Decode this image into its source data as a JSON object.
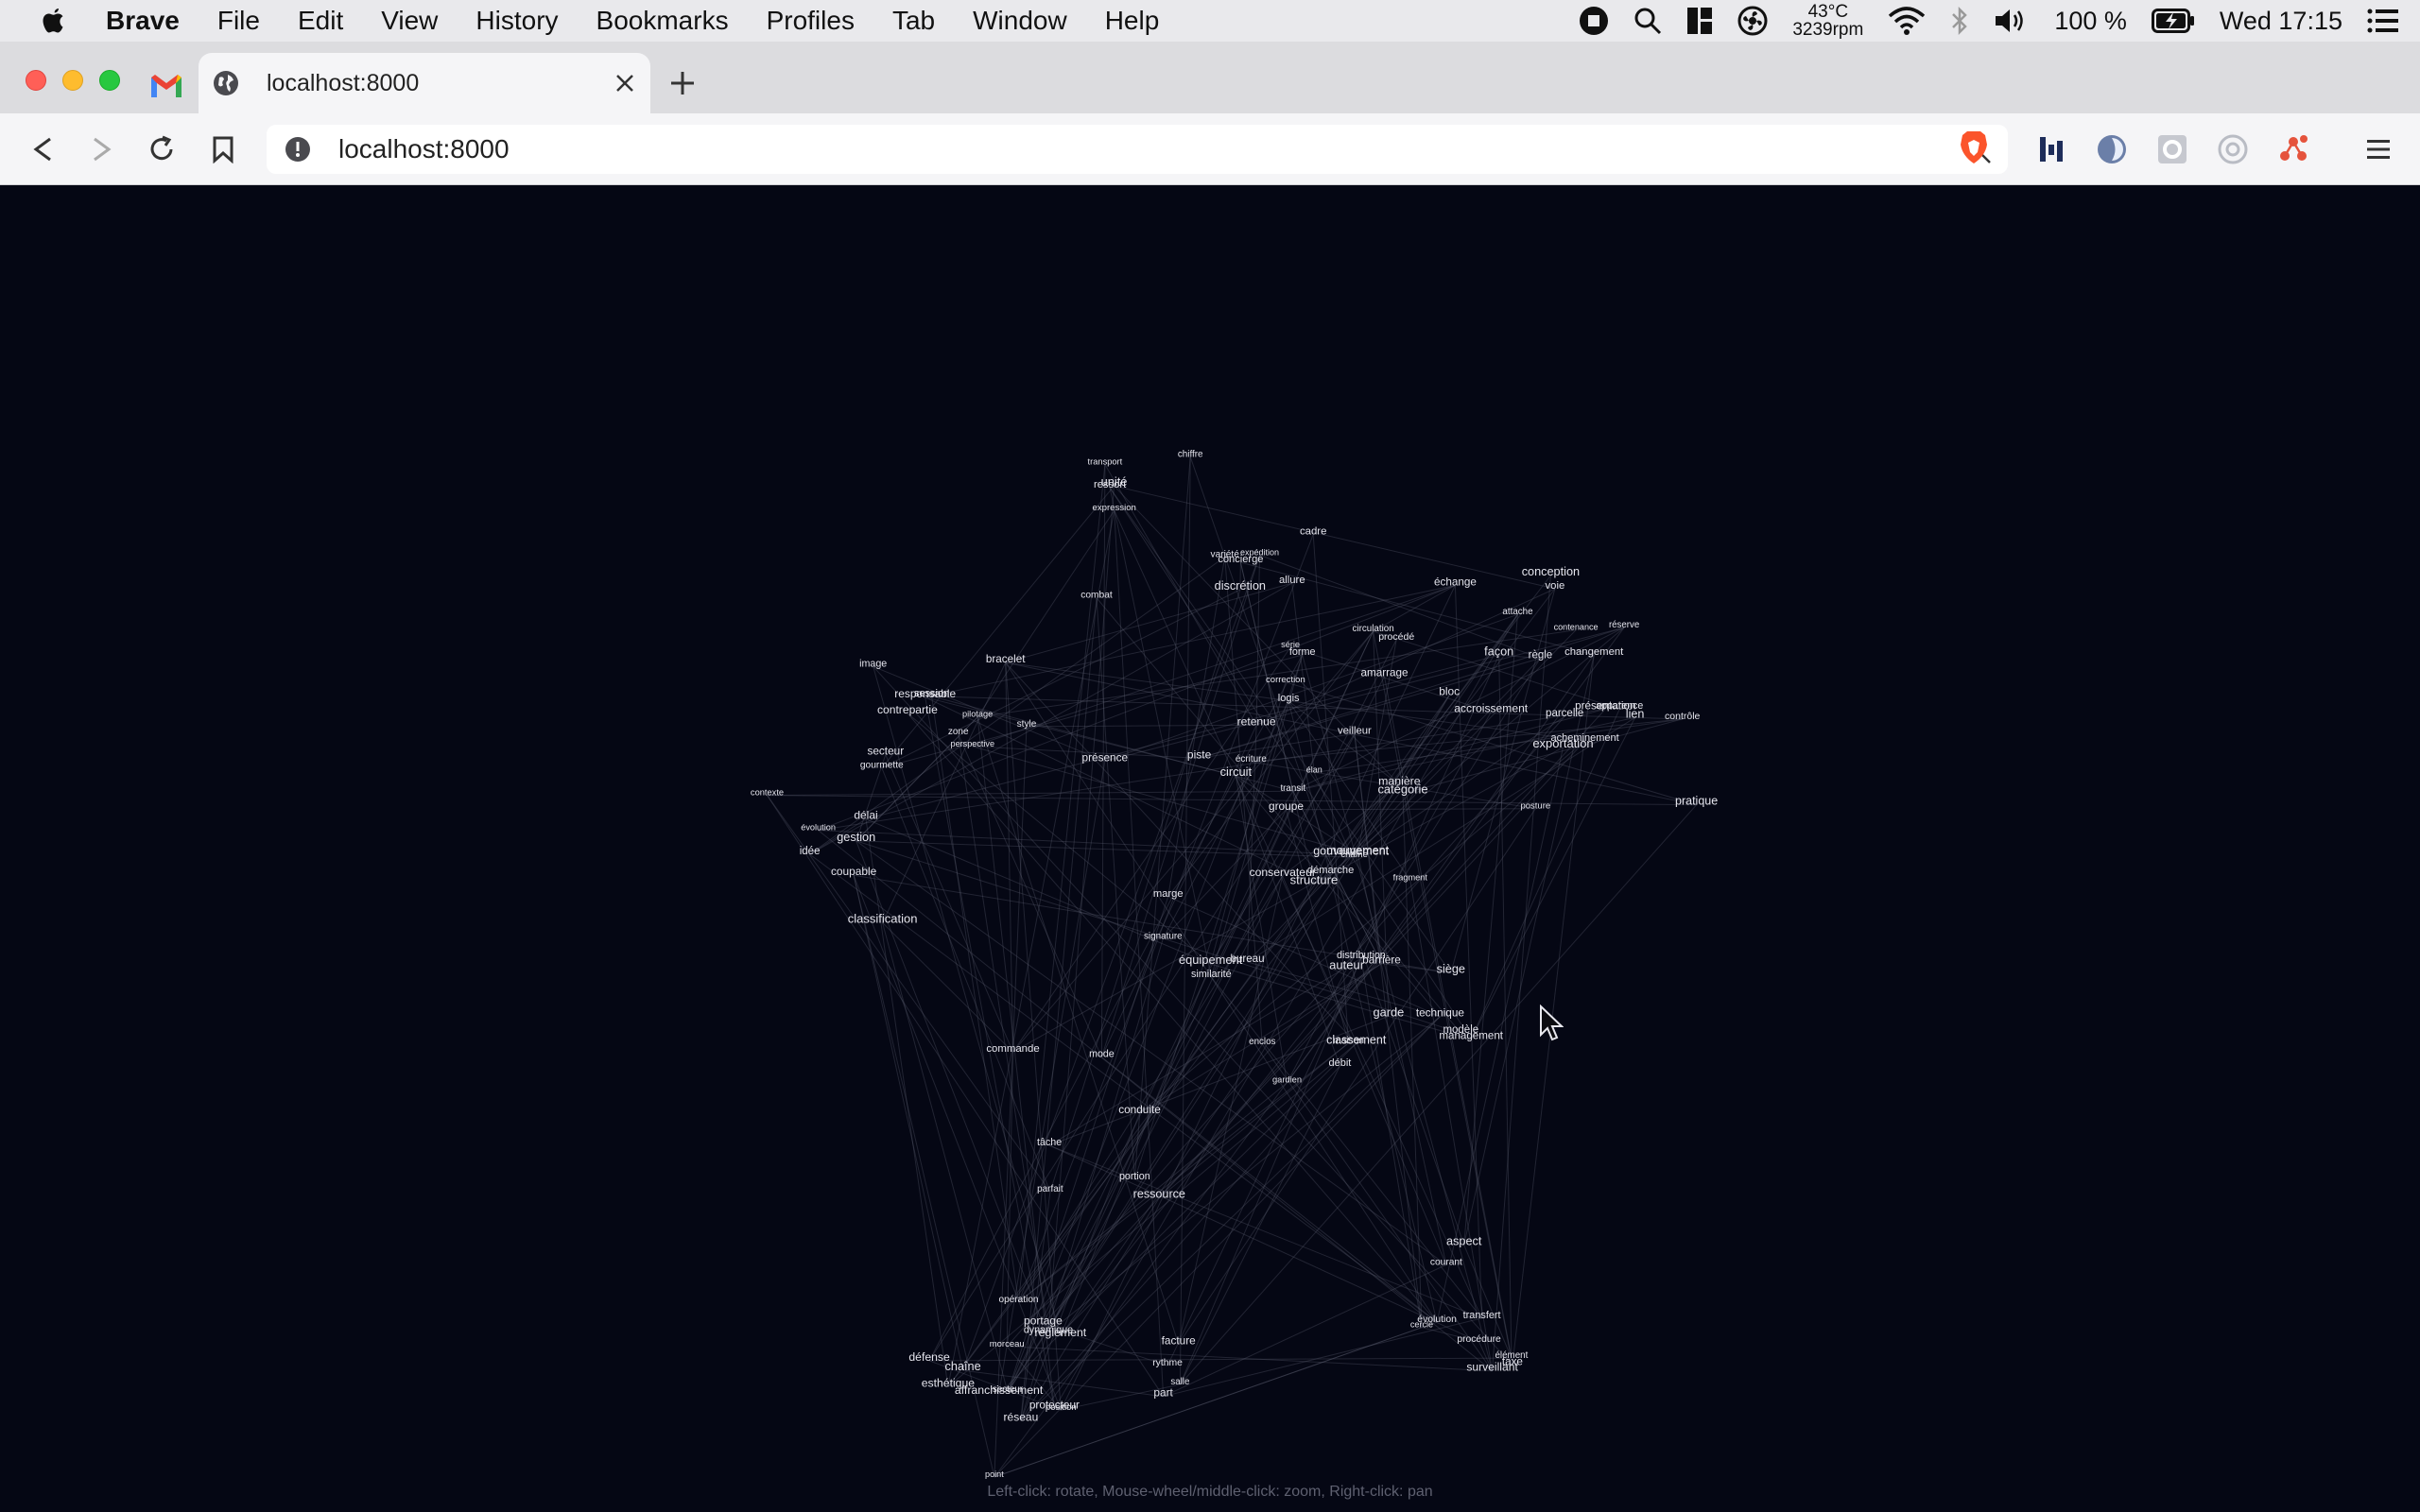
{
  "menubar": {
    "app_name": "Brave",
    "items": [
      "File",
      "Edit",
      "View",
      "History",
      "Bookmarks",
      "Profiles",
      "Tab",
      "Window",
      "Help"
    ],
    "status": {
      "temperature": "43°C",
      "fan": "3239rpm",
      "battery_percent": "100 %",
      "clock": "Wed 17:15"
    }
  },
  "browser": {
    "active_tab_title": "localhost:8000",
    "url": "localhost:8000"
  },
  "page": {
    "hint": "Left-click: rotate, Mouse-wheel/middle-click: zoom, Right-click: pan",
    "graph_labels": [
      "combat",
      "logis",
      "piste",
      "règle",
      "contrôle",
      "pilotage",
      "gestion",
      "démarche",
      "management",
      "ressource",
      "règlement",
      "courant",
      "chaîne",
      "gouvernement",
      "ressort",
      "circulation",
      "procédé",
      "façon",
      "apparence",
      "image",
      "idée",
      "similarité",
      "modèle",
      "conduite",
      "facture",
      "évolution",
      "esthétique",
      "manière",
      "expression",
      "écriture",
      "forme",
      "conception",
      "pratique",
      "style",
      "contexte",
      "signature",
      "technique",
      "parfait",
      "position",
      "aspect",
      "point",
      "catégorie",
      "variété",
      "allure",
      "présence",
      "contenance",
      "posture",
      "perspective",
      "classification",
      "distribution",
      "classement",
      "mode",
      "rythme",
      "procédure",
      "secteur",
      "structure",
      "discrétion",
      "correction",
      "retenue",
      "réserve",
      "présentation",
      "session",
      "délai",
      "marge",
      "maison",
      "tâche",
      "affranchissement",
      "taxe",
      "portage",
      "mouvement",
      "transport",
      "expédition",
      "transit",
      "échange",
      "exportation",
      "contrepartie",
      "évolution",
      "équipement",
      "débit",
      "commande",
      "opération",
      "transfert",
      "dynamique",
      "élan",
      "chiffre",
      "accroissement",
      "circuit",
      "changement",
      "acheminement",
      "responsable",
      "coupable",
      "auteur",
      "garde",
      "gardien",
      "protecteur",
      "surveillant",
      "défense",
      "conservateur",
      "concierge",
      "veilleur",
      "amarrage",
      "attache",
      "lien",
      "bracelet",
      "gourmette",
      "chaîne",
      "barrière",
      "enclos",
      "salle",
      "cercle",
      "réseau",
      "groupe",
      "cadre",
      "bloc",
      "série",
      "voie",
      "parcelle",
      "zone",
      "secteur",
      "bureau",
      "siège",
      "portion",
      "part",
      "élément",
      "morceau",
      "fragment",
      "unité"
    ]
  }
}
